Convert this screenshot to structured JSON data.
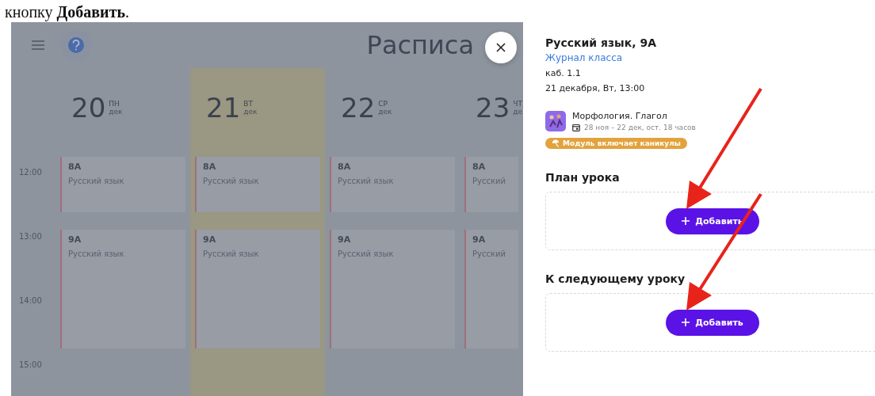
{
  "caption": "кнопку **Добавить**.",
  "calendar": {
    "title": "Расписа",
    "times": [
      "12:00",
      "13:00",
      "14:00",
      "15:00"
    ],
    "days": [
      {
        "date": "20",
        "weekday": "ПН",
        "month": "дек",
        "selected": false,
        "lessons": [
          {
            "class": "8А",
            "subject": "Русский язык"
          },
          {
            "class": "9А",
            "subject": "Русский язык"
          }
        ]
      },
      {
        "date": "21",
        "weekday": "ВТ",
        "month": "дек",
        "selected": true,
        "lessons": [
          {
            "class": "8А",
            "subject": "Русский язык"
          },
          {
            "class": "9А",
            "subject": "Русский язык"
          }
        ]
      },
      {
        "date": "22",
        "weekday": "СР",
        "month": "дек",
        "selected": false,
        "lessons": [
          {
            "class": "8А",
            "subject": "Русский язык"
          },
          {
            "class": "9А",
            "subject": "Русский язык"
          }
        ]
      },
      {
        "date": "23",
        "weekday": "ЧТ",
        "month": "де",
        "selected": false,
        "lessons": [
          {
            "class": "8А",
            "subject": "Русский"
          },
          {
            "class": "9А",
            "subject": "Русский"
          }
        ]
      }
    ]
  },
  "panel": {
    "title": "Русский язык, 9А",
    "link": "Журнал класса",
    "room": "каб. 1.1",
    "datetime": "21 декабря, Вт, 13:00",
    "module": {
      "name": "Морфология. Глагол",
      "period": "28 ноя – 22 дек, ост. 18 часов",
      "badge": "Модуль включает каникулы"
    },
    "sections": [
      {
        "heading": "План урока",
        "button": "Добавить"
      },
      {
        "heading": "К следующему уроку",
        "button": "Добавить"
      }
    ]
  }
}
